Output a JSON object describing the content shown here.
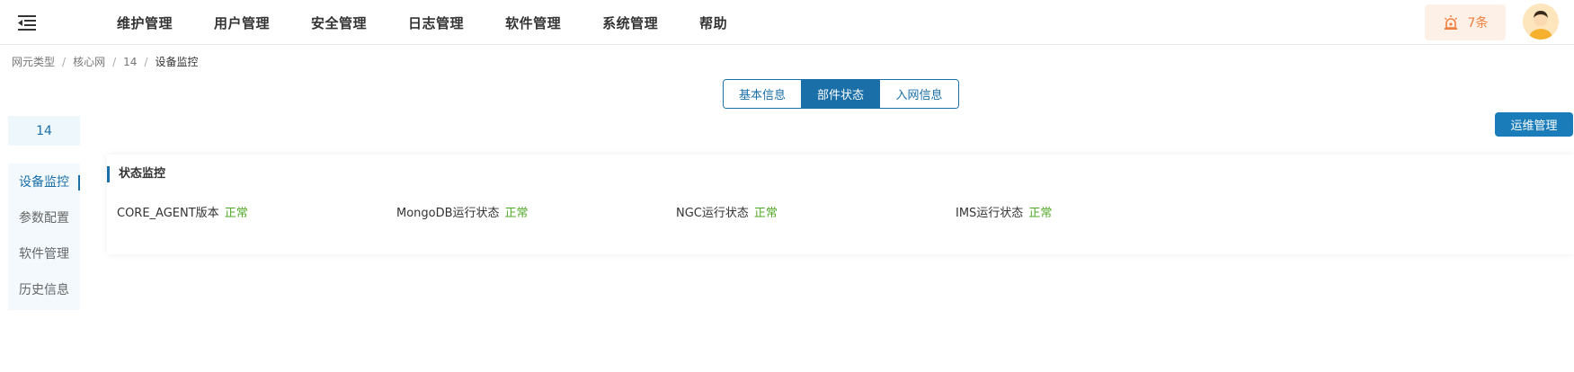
{
  "header": {
    "nav": [
      "维护管理",
      "用户管理",
      "安全管理",
      "日志管理",
      "软件管理",
      "系统管理",
      "帮助"
    ],
    "alarm_count": "7条",
    "colors": {
      "accent": "#1a6fa8",
      "alarm": "#f08040",
      "ok": "#52a82a"
    }
  },
  "breadcrumb": [
    "网元类型",
    "核心网",
    "14",
    "设备监控"
  ],
  "tabs": [
    "基本信息",
    "部件状态",
    "入网信息"
  ],
  "active_tab": "部件状态",
  "ops_button": "运维管理",
  "device_name": "14",
  "side_menu": [
    "设备监控",
    "参数配置",
    "软件管理",
    "历史信息"
  ],
  "card": {
    "title": "状态监控",
    "statuses": [
      {
        "label": "CORE_AGENT版本",
        "value": "正常"
      },
      {
        "label": "MongoDB运行状态",
        "value": "正常"
      },
      {
        "label": "NGC运行状态",
        "value": "正常"
      },
      {
        "label": "IMS运行状态",
        "value": "正常"
      }
    ]
  }
}
